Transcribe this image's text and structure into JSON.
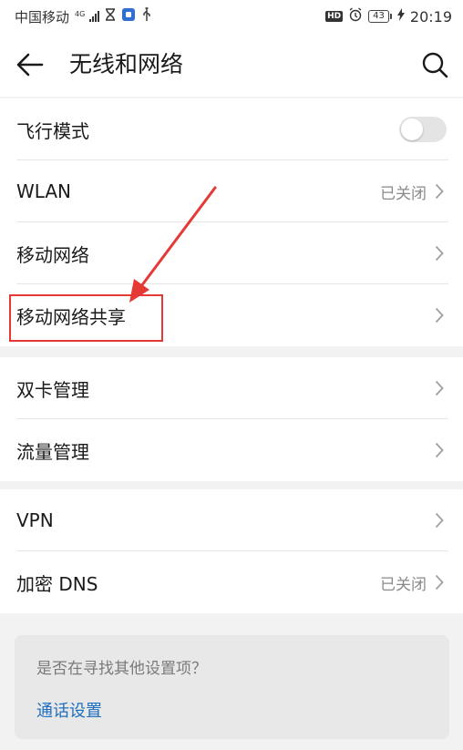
{
  "status_bar": {
    "carrier": "中国移动",
    "network_type": "4G",
    "hd_badge": "HD",
    "battery_level": "43",
    "time": "20:19"
  },
  "header": {
    "title": "无线和网络"
  },
  "groups": [
    {
      "items": [
        {
          "label": "飞行模式",
          "type": "toggle",
          "toggle_on": false
        },
        {
          "label": "WLAN",
          "value": "已关闭",
          "type": "chevron"
        },
        {
          "label": "移动网络",
          "type": "chevron"
        },
        {
          "label": "移动网络共享",
          "type": "chevron",
          "highlighted": true
        }
      ]
    },
    {
      "items": [
        {
          "label": "双卡管理",
          "type": "chevron"
        },
        {
          "label": "流量管理",
          "type": "chevron"
        }
      ]
    },
    {
      "items": [
        {
          "label": "VPN",
          "type": "chevron"
        },
        {
          "label": "加密 DNS",
          "value": "已关闭",
          "type": "chevron"
        }
      ]
    }
  ],
  "suggestions": {
    "question": "是否在寻找其他设置项？",
    "link": "通话设置"
  },
  "colors": {
    "annotation": "#e53935",
    "link": "#1f6fbf"
  }
}
